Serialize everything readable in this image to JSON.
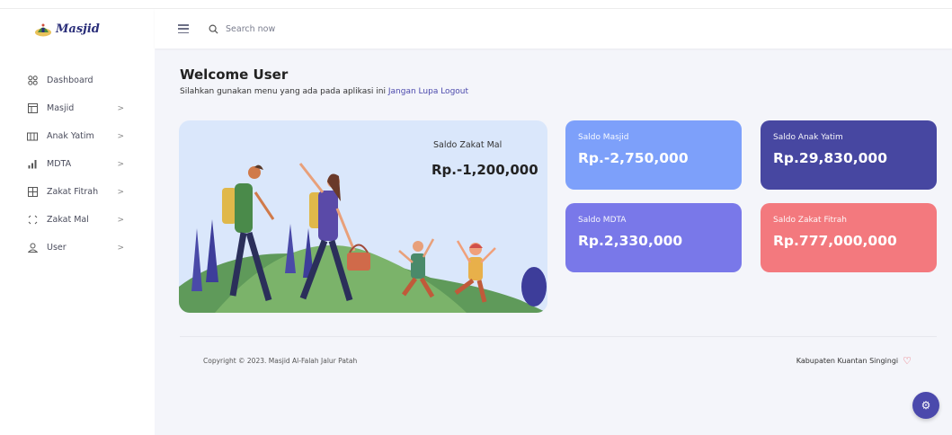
{
  "brand": {
    "name": "Masjid"
  },
  "search": {
    "placeholder": "Search now"
  },
  "sidebar": {
    "items": [
      {
        "label": "Dashboard",
        "icon": "grid-icon",
        "has_submenu": false
      },
      {
        "label": "Masjid",
        "icon": "layout-icon",
        "has_submenu": true
      },
      {
        "label": "Anak Yatim",
        "icon": "columns-icon",
        "has_submenu": true
      },
      {
        "label": "MDTA",
        "icon": "bar-chart-icon",
        "has_submenu": true
      },
      {
        "label": "Zakat Fitrah",
        "icon": "table-icon",
        "has_submenu": true
      },
      {
        "label": "Zakat Mal",
        "icon": "expand-icon",
        "has_submenu": true
      },
      {
        "label": "User",
        "icon": "user-icon",
        "has_submenu": true
      }
    ],
    "chevron": ">"
  },
  "welcome": {
    "title": "Welcome User",
    "subtitle": "Silahkan gunakan menu yang ada pada aplikasi ini",
    "logout_link": "Jangan Lupa Logout"
  },
  "hero": {
    "label": "Saldo Zakat Mal",
    "value": "Rp.-1,200,000"
  },
  "cards": {
    "masjid": {
      "label": "Saldo Masjid",
      "value": "Rp.-2,750,000",
      "color": "#7da0fa"
    },
    "yatim": {
      "label": "Saldo Anak Yatim",
      "value": "Rp.29,830,000",
      "color": "#4747a1"
    },
    "mdta": {
      "label": "Saldo MDTA",
      "value": "Rp.2,330,000",
      "color": "#7978e9"
    },
    "fitrah": {
      "label": "Saldo Zakat Fitrah",
      "value": "Rp.777,000,000",
      "color": "#f3797e"
    }
  },
  "footer": {
    "copyright": "Copyright © 2023. Masjid Al-Falah Jalur Patah",
    "location": "Kabupaten Kuantan Singingi"
  },
  "colors": {
    "accent": "#4b49ac",
    "heart": "#e8505b"
  }
}
